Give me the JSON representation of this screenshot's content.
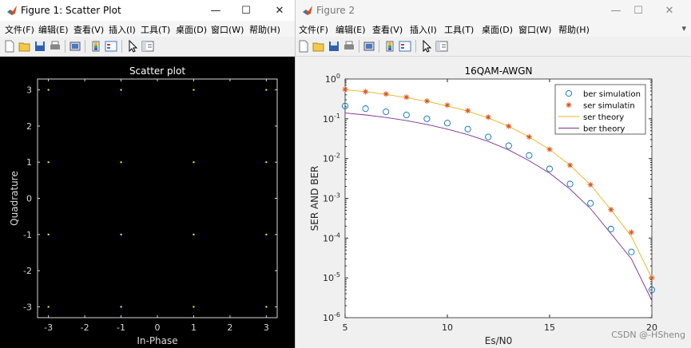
{
  "window1": {
    "title": "Figure 1: Scatter Plot",
    "menu": [
      "文件(F)",
      "编辑(E)",
      "查看(V)",
      "插入(I)",
      "工具(T)",
      "桌面(D)",
      "窗口(W)",
      "帮助(H)"
    ],
    "controls": {
      "minimize": "—",
      "maximize": "☐",
      "close": "✕"
    }
  },
  "window2": {
    "title": "Figure 2",
    "menu": [
      "文件(F)",
      "编辑(E)",
      "查看(V)",
      "插入(I)",
      "工具(T)",
      "桌面(D)",
      "窗口(W)",
      "帮助(H)"
    ],
    "controls": {
      "minimize": "—",
      "maximize": "☐",
      "close": "✕"
    }
  },
  "toolbar_icons": [
    "new-figure-icon",
    "open-file-icon",
    "save-icon",
    "print-icon",
    "link-plot-icon",
    "insert-colorbar-icon",
    "insert-legend-icon",
    "edit-plot-icon",
    "property-inspector-icon"
  ],
  "watermark": "CSDN @-HSheng",
  "chart_data": [
    {
      "type": "scatter",
      "title": "Scatter plot",
      "xlabel": "In-Phase",
      "ylabel": "Quadrature",
      "xlim": [
        -3.3,
        3.3
      ],
      "ylim": [
        -3.3,
        3.3
      ],
      "xticks": [
        "-3",
        "-2",
        "-1",
        "0",
        "1",
        "2",
        "3"
      ],
      "yticks": [
        "3",
        "2",
        "1",
        "0",
        "-1",
        "-2",
        "-3"
      ],
      "grid": false,
      "background": "#000000",
      "marker_color": "#ffff00",
      "points_x": [
        -3,
        -1,
        1,
        3
      ],
      "points_y": [
        -3,
        -1,
        1,
        3
      ]
    },
    {
      "type": "line",
      "title": "16QAM-AWGN",
      "xlabel": "Es/N0",
      "ylabel": "SER AND BER",
      "yscale": "log",
      "xlim": [
        5,
        20
      ],
      "ylim": [
        1e-06,
        1
      ],
      "xticks": [
        "5",
        "10",
        "15",
        "20"
      ],
      "yticks": [
        {
          "base": "10",
          "exp": "0"
        },
        {
          "base": "10",
          "exp": "-1"
        },
        {
          "base": "10",
          "exp": "-2"
        },
        {
          "base": "10",
          "exp": "-3"
        },
        {
          "base": "10",
          "exp": "-4"
        },
        {
          "base": "10",
          "exp": "-5"
        },
        {
          "base": "10",
          "exp": "-6"
        }
      ],
      "legend_position": "top-right",
      "x": [
        5,
        6,
        7,
        8,
        9,
        10,
        11,
        12,
        13,
        14,
        15,
        16,
        17,
        18,
        19,
        20
      ],
      "series": [
        {
          "name": "ber simulation",
          "style": "circle-markers",
          "color": "#0072bd",
          "values": [
            0.21,
            0.18,
            0.15,
            0.125,
            0.1,
            0.078,
            0.055,
            0.035,
            0.021,
            0.012,
            0.0055,
            0.0023,
            0.00075,
            0.00017,
            4.5e-05,
            5e-06
          ]
        },
        {
          "name": "ser simulatin",
          "style": "asterisk-markers",
          "color": "#d95319",
          "values": [
            0.55,
            0.48,
            0.42,
            0.35,
            0.28,
            0.22,
            0.16,
            0.11,
            0.065,
            0.035,
            0.017,
            0.0068,
            0.0022,
            0.00052,
            0.00014,
            1e-05
          ]
        },
        {
          "name": "ser theory",
          "style": "line",
          "color": "#edb120",
          "values": [
            0.54,
            0.48,
            0.41,
            0.34,
            0.275,
            0.21,
            0.155,
            0.105,
            0.065,
            0.035,
            0.017,
            0.0068,
            0.0022,
            0.00052,
            0.00011,
            9.8e-06
          ]
        },
        {
          "name": "ber theory",
          "style": "line",
          "color": "#7e2f8e",
          "values": [
            0.14,
            0.125,
            0.108,
            0.09,
            0.072,
            0.055,
            0.04,
            0.027,
            0.0165,
            0.0088,
            0.0043,
            0.0017,
            0.00055,
            0.00013,
            3e-05,
            2.7e-06
          ]
        }
      ]
    }
  ]
}
